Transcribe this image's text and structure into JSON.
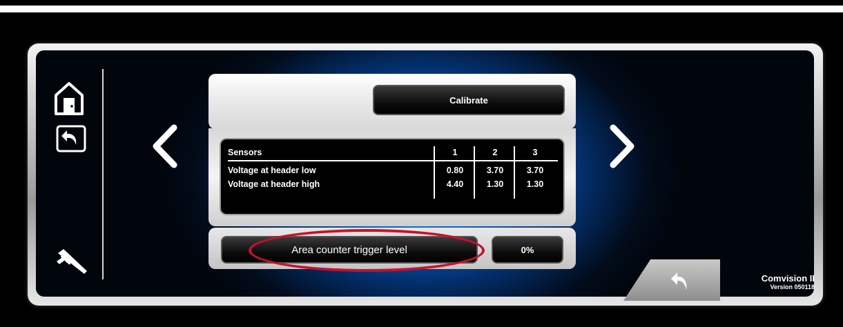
{
  "calibrate_label": "Calibrate",
  "table": {
    "header": {
      "label": "Sensors",
      "cols": [
        "1",
        "2",
        "3"
      ]
    },
    "rows": [
      {
        "label": "Voltage at header low",
        "values": [
          "0.80",
          "3.70",
          "3.70"
        ]
      },
      {
        "label": "Voltage at header high",
        "values": [
          "4.40",
          "1.30",
          "1.30"
        ]
      }
    ]
  },
  "trigger_label": "Area counter trigger level",
  "trigger_value": "0%",
  "brand": {
    "name": "Comvision II",
    "version": "Version 050118"
  },
  "icons": {
    "home": "home-icon",
    "back": "back-icon",
    "tool": "caliper-icon",
    "prev": "chevron-left-icon",
    "next": "chevron-right-icon",
    "corner_back": "back-icon"
  },
  "colors": {
    "accent_blue": "#1a8cff",
    "highlight_red": "#c8102e"
  }
}
